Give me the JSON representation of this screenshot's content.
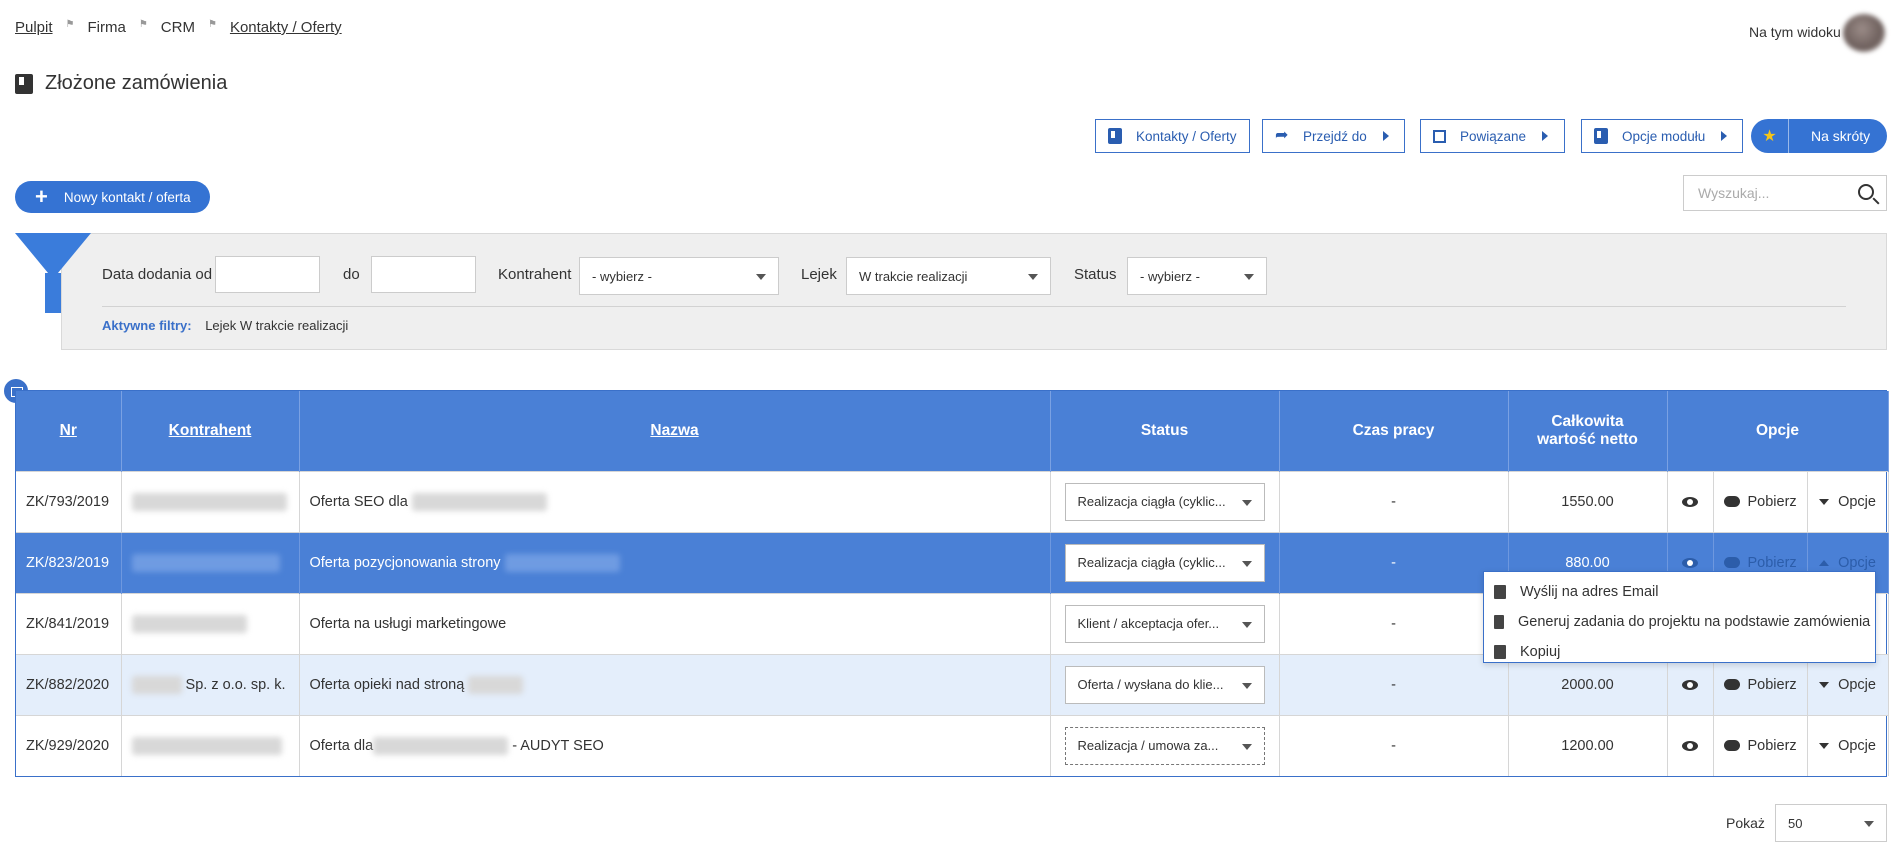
{
  "breadcrumb": [
    {
      "label": "Pulpit"
    },
    {
      "label": "Firma"
    },
    {
      "label": "CRM"
    },
    {
      "label": "Kontakty / Oferty"
    }
  ],
  "viewers_text": "Na tym widoku",
  "page_title": "Złożone zamówienia",
  "toolbar": {
    "contacts_label": "Kontakty / Oferty",
    "goto_label": "Przejdź do",
    "related_label": "Powiązane",
    "module_options_label": "Opcje modułu",
    "shortcuts_label": "Na skróty"
  },
  "new_contact_label": "Nowy kontakt / oferta",
  "search": {
    "placeholder": "Wyszukaj..."
  },
  "filters": {
    "date_from_label": "Data dodania od",
    "date_from_value": "",
    "date_to_label": "do",
    "date_to_value": "",
    "contractor_label": "Kontrahent",
    "contractor_value": "- wybierz -",
    "funnel_label": "Lejek",
    "funnel_value": "W trakcie realizacji",
    "status_label": "Status",
    "status_value": "- wybierz -",
    "active_label": "Aktywne filtry:",
    "active_value": "Lejek W trakcie realizacji"
  },
  "table": {
    "headers": {
      "nr": "Nr",
      "contractor": "Kontrahent",
      "name": "Nazwa",
      "status": "Status",
      "work_time": "Czas pracy",
      "total_line1": "Całkowita",
      "total_line2": "wartość netto",
      "options": "Opcje"
    },
    "rows": [
      {
        "nr": "ZK/793/2019",
        "contractor_suffix": "",
        "name_prefix": "Oferta SEO dla",
        "name_suffix": "",
        "status": "Realizacja ciągła (cyklic...",
        "work_time": "-",
        "total": "1550.00",
        "download": "Pobierz",
        "options": "Opcje"
      },
      {
        "nr": "ZK/823/2019",
        "contractor_suffix": "",
        "name_prefix": "Oferta pozycjonowania strony",
        "name_suffix": "",
        "status": "Realizacja ciągła (cyklic...",
        "work_time": "-",
        "total": "880.00",
        "download": "Pobierz",
        "options": "Opcje"
      },
      {
        "nr": "ZK/841/2019",
        "contractor_suffix": "",
        "name_prefix": "Oferta na usługi marketingowe",
        "name_suffix": "",
        "status": "Klient / akceptacja ofer...",
        "work_time": "-",
        "total": "",
        "download": "",
        "options": ""
      },
      {
        "nr": "ZK/882/2020",
        "contractor_suffix": "Sp. z o.o. sp. k.",
        "name_prefix": "Oferta opieki nad stroną",
        "name_suffix": "",
        "status": "Oferta / wysłana do klie...",
        "work_time": "-",
        "total": "2000.00",
        "download": "Pobierz",
        "options": "Opcje"
      },
      {
        "nr": "ZK/929/2020",
        "contractor_suffix": "",
        "name_prefix": "Oferta dla",
        "name_suffix": "- AUDYT SEO",
        "status": "Realizacja / umowa za...",
        "work_time": "-",
        "total": "1200.00",
        "download": "Pobierz",
        "options": "Opcje"
      }
    ]
  },
  "row_menu": [
    {
      "label": "Wyślij na adres Email",
      "icon": "email-send-icon"
    },
    {
      "label": "Generuj zadania do projektu na podstawie zamówienia",
      "icon": "document-icon"
    },
    {
      "label": "Kopiuj",
      "icon": "copy-icon"
    }
  ],
  "pagination": {
    "show_label": "Pokaż",
    "page_size": "50"
  },
  "colors": {
    "accent": "#3573d3",
    "header_bg": "#4a80d6",
    "selected_row": "#4a80d6",
    "alt_row": "#e4eefb"
  }
}
